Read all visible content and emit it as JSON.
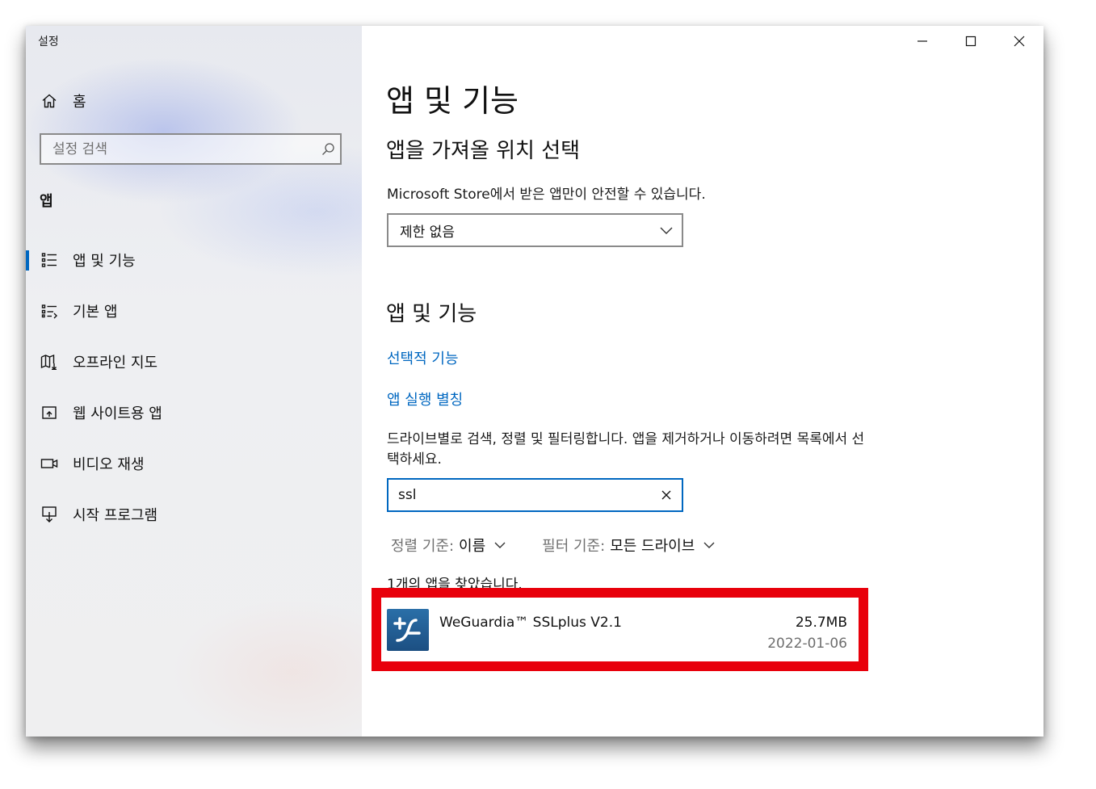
{
  "window": {
    "title": "설정"
  },
  "sidebar": {
    "home_label": "홈",
    "search_placeholder": "설정 검색",
    "section_label": "앱",
    "items": [
      {
        "label": "앱 및 기능",
        "icon": "apps-features-icon",
        "selected": true
      },
      {
        "label": "기본 앱",
        "icon": "default-apps-icon"
      },
      {
        "label": "오프라인 지도",
        "icon": "offline-maps-icon"
      },
      {
        "label": "웹 사이트용 앱",
        "icon": "apps-for-websites-icon"
      },
      {
        "label": "비디오 재생",
        "icon": "video-playback-icon"
      },
      {
        "label": "시작 프로그램",
        "icon": "startup-icon"
      }
    ]
  },
  "main": {
    "title": "앱 및 기능",
    "source_heading": "앱을 가져올 위치 선택",
    "source_desc": "Microsoft Store에서 받은 앱만이 안전할 수 있습니다.",
    "source_value": "제한 없음",
    "apps_heading": "앱 및 기능",
    "link_optional": "선택적 기능",
    "link_alias": "앱 실행 별칭",
    "search_desc": "드라이브별로 검색, 정렬 및 필터링합니다. 앱을 제거하거나 이동하려면 목록에서 선택하세요.",
    "search_value": "ssl",
    "sort_key": "정렬 기준:",
    "sort_value": "이름",
    "filter_key": "필터 기준:",
    "filter_value": "모든 드라이브",
    "found_text": "1개의 앱을 찾았습니다.",
    "apps": [
      {
        "name": "WeGuardia™ SSLplus V2.1",
        "size": "25.7MB",
        "date": "2022-01-06"
      }
    ]
  },
  "colors": {
    "accent": "#0067c0",
    "highlight": "#e8000b"
  }
}
